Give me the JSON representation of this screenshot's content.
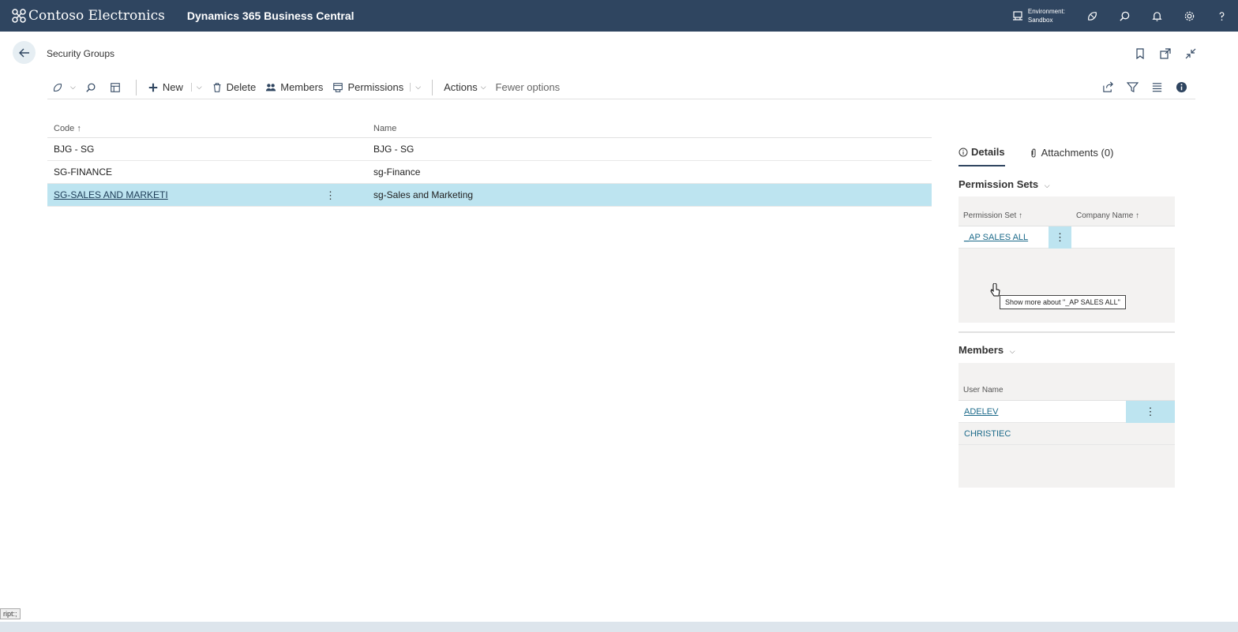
{
  "topbar": {
    "company": "Contoso Electronics",
    "product": "Dynamics 365 Business Central",
    "environment_label": "Environment:",
    "environment_value": "Sandbox",
    "icons": [
      "copilot-icon",
      "search-icon",
      "bell-icon",
      "gear-icon",
      "help-icon"
    ]
  },
  "page": {
    "title": "Security Groups"
  },
  "actionbar": {
    "new_label": "New",
    "delete_label": "Delete",
    "members_label": "Members",
    "permissions_label": "Permissions",
    "actions_label": "Actions",
    "fewer_label": "Fewer options"
  },
  "list": {
    "columns": [
      "Code ↑",
      "Name"
    ],
    "rows": [
      {
        "code": "BJG - SG",
        "name": "BJG - SG"
      },
      {
        "code": "SG-FINANCE",
        "name": "sg-Finance"
      },
      {
        "code": "SG-SALES AND MARKETI",
        "name": "sg-Sales and Marketing"
      }
    ],
    "selected_row": 2
  },
  "factbox": {
    "tabs": [
      "Details",
      "Attachments (0)"
    ],
    "permission_sets": {
      "title": "Permission Sets",
      "columns": [
        "Permission Set ↑",
        "Company Name ↑"
      ],
      "rows": [
        "_AP SALES ALL"
      ]
    },
    "tooltip": "Show more about \"_AP SALES ALL\"",
    "members": {
      "title": "Members",
      "column": "User Name",
      "rows": [
        "ADELEV",
        "CHRISTIEC"
      ]
    }
  },
  "status": {
    "text": "ript:;"
  },
  "colors": {
    "topbar": "#2f4560",
    "selected_row": "#bde4f0",
    "link": "#1c6a8a"
  }
}
